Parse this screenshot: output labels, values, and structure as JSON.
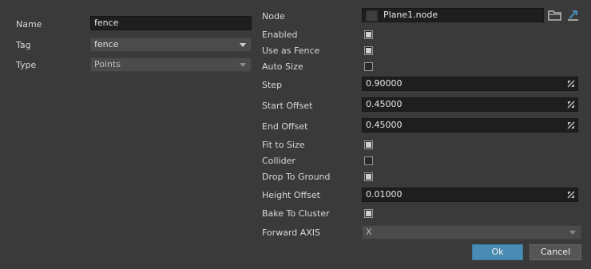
{
  "left": {
    "name": {
      "label": "Name",
      "value": "fence"
    },
    "tag": {
      "label": "Tag",
      "value": "fence"
    },
    "type": {
      "label": "Type",
      "value": "Points"
    }
  },
  "right": {
    "node": {
      "label": "Node",
      "value": "Plane1.node"
    },
    "enabled": {
      "label": "Enabled",
      "checked": true
    },
    "use_as_fence": {
      "label": "Use as Fence",
      "checked": true
    },
    "auto_size": {
      "label": "Auto Size",
      "checked": false
    },
    "step": {
      "label": "Step",
      "value": "0.90000"
    },
    "start_offset": {
      "label": "Start Offset",
      "value": "0.45000"
    },
    "end_offset": {
      "label": "End Offset",
      "value": "0.45000"
    },
    "fit_to_size": {
      "label": "Fit to Size",
      "checked": true
    },
    "collider": {
      "label": "Collider",
      "checked": false
    },
    "drop_to_ground": {
      "label": "Drop To Ground",
      "checked": true
    },
    "height_offset": {
      "label": "Height Offset",
      "value": "0.01000"
    },
    "bake_to_cluster": {
      "label": "Bake To Cluster",
      "checked": true
    },
    "forward_axis": {
      "label": "Forward AXIS",
      "value": "X"
    }
  },
  "buttons": {
    "ok": "Ok",
    "cancel": "Cancel"
  },
  "icons": {
    "browse": "folder-icon",
    "open": "open-arrow-icon"
  },
  "colors": {
    "accent": "#4a8bb3",
    "background": "#3a3a3b",
    "field": "#1e1e1f"
  }
}
